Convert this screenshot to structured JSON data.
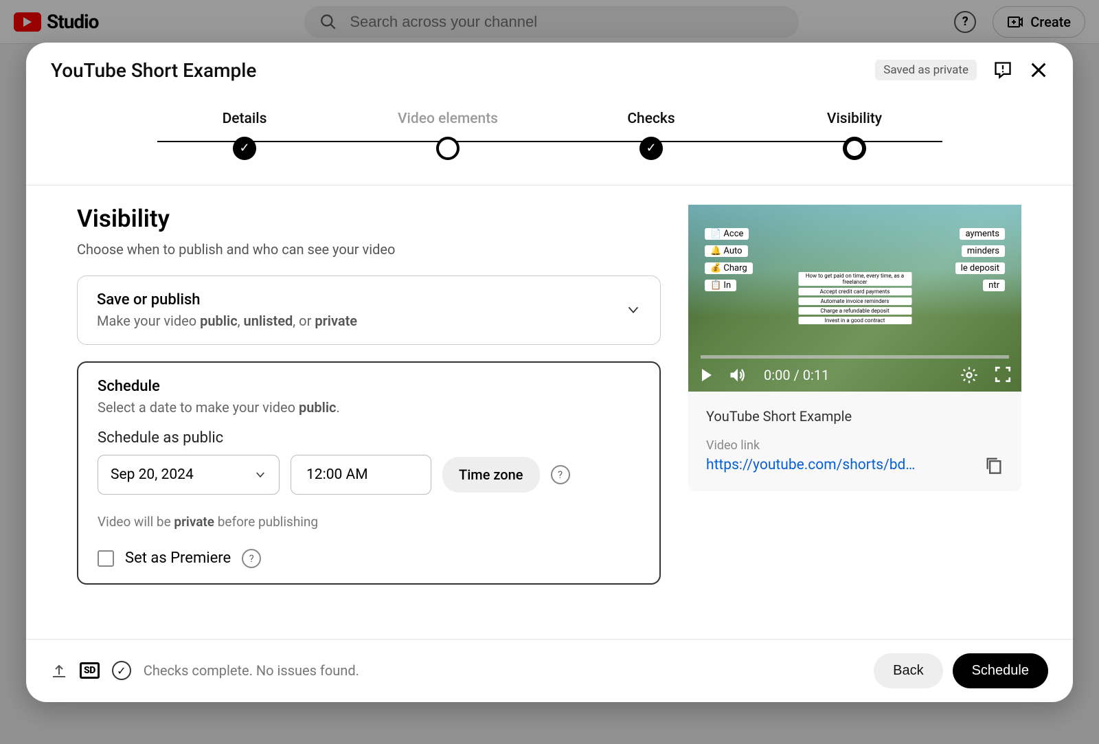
{
  "header": {
    "logo_text": "Studio",
    "search_placeholder": "Search across your channel",
    "create_label": "Create"
  },
  "dialog": {
    "title": "YouTube Short Example",
    "saved_badge": "Saved as private",
    "stepper": {
      "details": "Details",
      "video_elements": "Video elements",
      "checks": "Checks",
      "visibility": "Visibility"
    },
    "visibility": {
      "heading": "Visibility",
      "sub": "Choose when to publish and who can see your video"
    },
    "save_card": {
      "title": "Save or publish",
      "sub_lead": "Make your video ",
      "opt1": "public",
      "sep1": ", ",
      "opt2": "unlisted",
      "sep2": ", or ",
      "opt3": "private"
    },
    "schedule_card": {
      "title": "Schedule",
      "sub_lead": "Select a date to make your video ",
      "sub_bold": "public",
      "sub_trail": ".",
      "label": "Schedule as public",
      "date": "Sep 20, 2024",
      "time": "12:00 AM",
      "tz": "Time zone",
      "note_lead": "Video will be ",
      "note_bold": "private",
      "note_trail": " before publishing",
      "premiere": "Set as Premiere"
    },
    "preview": {
      "current_time": "0:00",
      "divider": " / ",
      "duration": "0:11",
      "title": "YouTube Short Example",
      "link_label": "Video link",
      "link": "https://youtube.com/shorts/bd…"
    },
    "footer": {
      "sd": "SD",
      "checks_text": "Checks complete. No issues found.",
      "back": "Back",
      "schedule": "Schedule"
    }
  }
}
